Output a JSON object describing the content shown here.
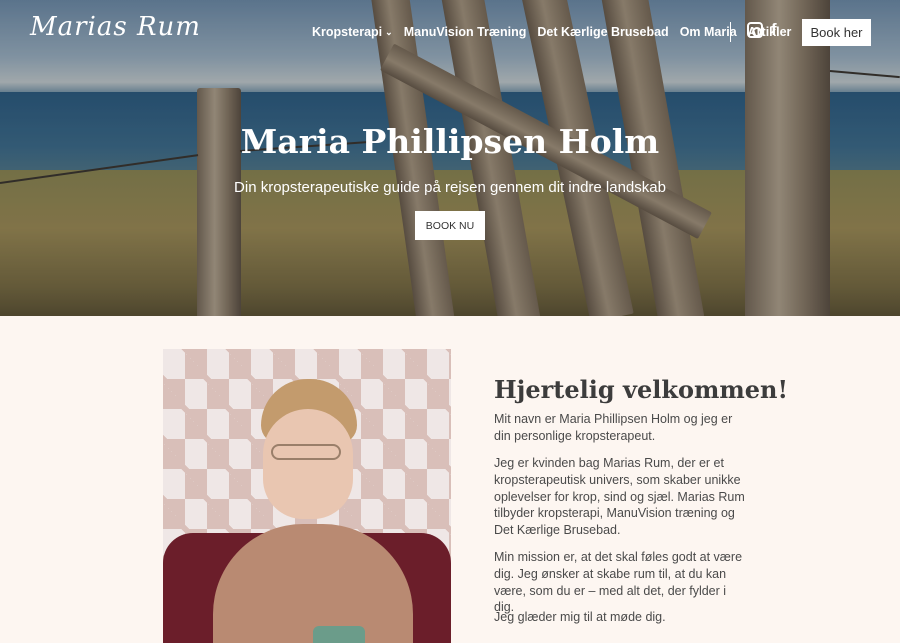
{
  "header": {
    "logo": "Marias Rum",
    "nav": [
      {
        "label": "Kropsterapi",
        "dropdown": true
      },
      {
        "label": "ManuVision Træning"
      },
      {
        "label": "Det Kærlige Brusebad"
      },
      {
        "label": "Om Maria"
      },
      {
        "label": "Artikler"
      }
    ],
    "dropdown_glyph": "⌄",
    "facebook_glyph": "f",
    "book_label": "Book her"
  },
  "hero": {
    "title": "Maria Phillipsen Holm",
    "subtitle": "Din kropsterapeutiske guide på rejsen gennem dit indre landskab",
    "cta_label": "BOOK NU"
  },
  "welcome": {
    "heading": "Hjertelig velkommen!",
    "paragraphs": [
      "Mit navn er Maria Phillipsen Holm og jeg er din personlige kropsterapeut.",
      "Jeg er kvinden bag Marias Rum, der er et kropsterapeutisk univers, som skaber unikke oplevelser for krop, sind og sjæl. Marias Rum tilbyder kropsterapi, ManuVision træning og Det Kærlige Brusebad.",
      "Min mission er, at det skal føles godt at være dig. Jeg ønsker at skabe rum til, at du kan være, som du er – med alt det, der fylder i dig.",
      "Jeg glæder mig til at møde dig."
    ]
  }
}
